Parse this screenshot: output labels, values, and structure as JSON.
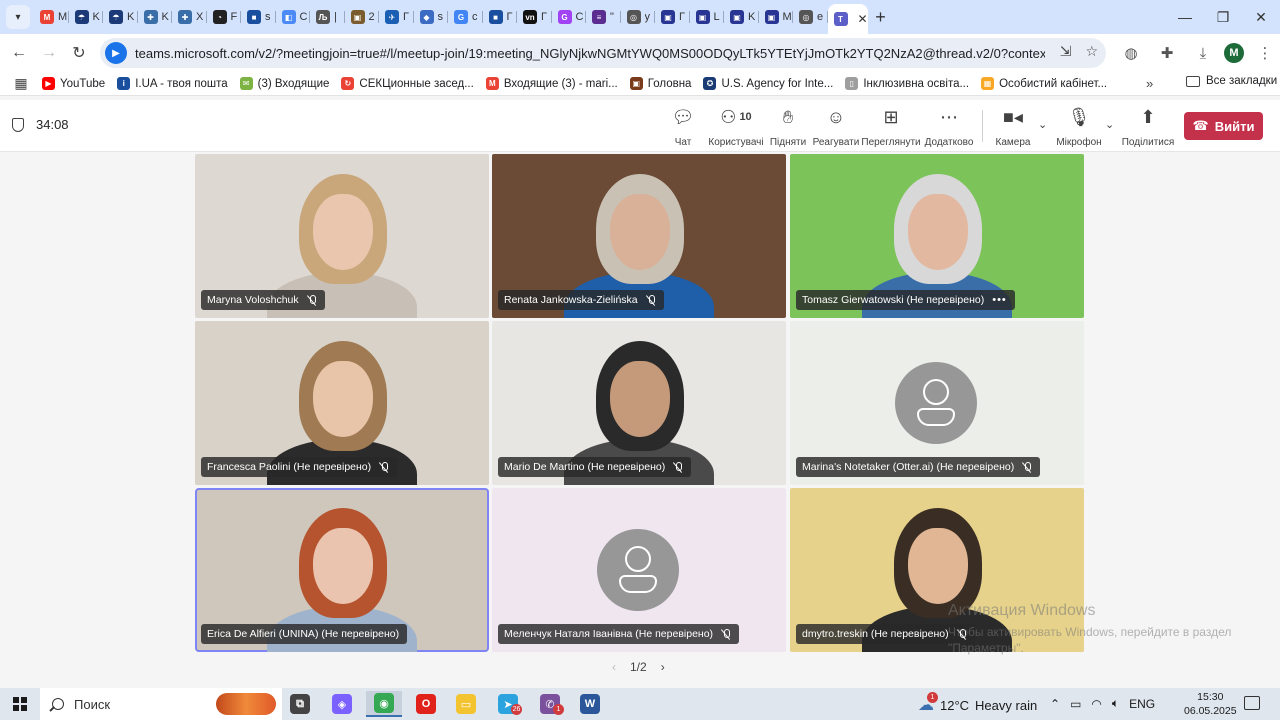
{
  "browser": {
    "tabs": [
      {
        "letter": "M",
        "color": "#ea4335",
        "glyph": "M"
      },
      {
        "letter": "K",
        "color": "#1d3a78",
        "glyph": "☂"
      },
      {
        "letter": "K",
        "color": "#1d3a78",
        "glyph": "☂"
      },
      {
        "letter": "K",
        "color": "#3a6ea8",
        "glyph": "✚"
      },
      {
        "letter": "X",
        "color": "#3a6ea8",
        "glyph": "✚"
      },
      {
        "letter": "F",
        "color": "#222222",
        "glyph": "◔"
      },
      {
        "letter": "s",
        "color": "#1a4fa0",
        "glyph": "■"
      },
      {
        "letter": "C",
        "color": "#4c8bf5",
        "glyph": "◧"
      },
      {
        "letter": "|",
        "color": "#555555",
        "glyph": "Љ"
      },
      {
        "letter": "2",
        "color": "#7a5c2e",
        "glyph": "▣"
      },
      {
        "letter": "Г",
        "color": "#1a5fb4",
        "glyph": "✈"
      },
      {
        "letter": "s",
        "color": "#3c6bc4",
        "glyph": "◆"
      },
      {
        "letter": "c",
        "color": "#4285f4",
        "glyph": "G"
      },
      {
        "letter": "Г",
        "color": "#1a4fa0",
        "glyph": "■"
      },
      {
        "letter": "Г",
        "color": "#111111",
        "glyph": "vn"
      },
      {
        "letter": "C",
        "color": "#a142f4",
        "glyph": "G"
      },
      {
        "letter": "\"",
        "color": "#5b2d91",
        "glyph": "≡"
      },
      {
        "letter": "y",
        "color": "#555555",
        "glyph": "◎"
      },
      {
        "letter": "Г",
        "color": "#283593",
        "glyph": "▣"
      },
      {
        "letter": "L",
        "color": "#283593",
        "glyph": "▣"
      },
      {
        "letter": "K",
        "color": "#283593",
        "glyph": "▣"
      },
      {
        "letter": "M",
        "color": "#283593",
        "glyph": "▣"
      },
      {
        "letter": "e",
        "color": "#555555",
        "glyph": "◎"
      }
    ],
    "active_tab": {
      "letter": "M",
      "color": "#5b5fc7"
    },
    "url": "teams.microsoft.com/v2/?meetingjoin=true#/l/meetup-join/19:meeting_NGlyNjkwNGMtYWQ0MS00ODQyLTk5YTEtYjJmOTk2YTQ2NzA2@thread.v2/0?context=%7b\"Tid\"%3a\"5...",
    "profile_initial": "M",
    "bookmarks": [
      {
        "label": "YouTube",
        "color": "#ff0000",
        "glyph": "▶"
      },
      {
        "label": "I.UA - твоя пошта",
        "color": "#1a4fa0",
        "glyph": "i"
      },
      {
        "label": "(3) Входящие",
        "color": "#7cb342",
        "glyph": "✉"
      },
      {
        "label": "СЕКЦионные засед...",
        "color": "#ea4335",
        "glyph": "↻"
      },
      {
        "label": "Входящие (3) - mari...",
        "color": "#ea4335",
        "glyph": "M"
      },
      {
        "label": "Головна",
        "color": "#7a3b1a",
        "glyph": "▣"
      },
      {
        "label": "U.S. Agency for Inte...",
        "color": "#1a3b73",
        "glyph": "✪"
      },
      {
        "label": "Інклюзивна освіта...",
        "color": "#9e9e9e",
        "glyph": "▯"
      },
      {
        "label": "Особистий кабінет...",
        "color": "#f9a825",
        "glyph": "▦"
      }
    ],
    "bookmarks_all": "Все закладки"
  },
  "meeting": {
    "timer": "34:08",
    "toolbar": {
      "chat": "Чат",
      "people": "Користувачі",
      "people_count": "10",
      "raise": "Підняти",
      "react": "Реагувати",
      "view": "Переглянути",
      "more": "Додатково",
      "camera": "Камера",
      "mic": "Мікрофон",
      "share": "Поділитися",
      "leave": "Вийти"
    },
    "participants": [
      {
        "name": "Maryna Voloshchuk",
        "muted": true,
        "more": false,
        "bg": "#ddd8d2",
        "hair": "#c9a77a",
        "skin": "#e9c6ad",
        "shirt": "#c8bfb6",
        "avatar": false
      },
      {
        "name": "Renata Jankowska-Zielińska",
        "muted": true,
        "more": false,
        "bg": "#6b4a36",
        "hair": "#c9c2b4",
        "skin": "#d9b098",
        "shirt": "#1f5ea8",
        "avatar": false
      },
      {
        "name": "Tomasz Gierwatowski (Не перевірено)",
        "muted": false,
        "more": true,
        "bg": "#7cc35a",
        "hair": "#d8d8d8",
        "skin": "#e2b8a0",
        "shirt": "#3a6ea8",
        "avatar": false
      },
      {
        "name": "Francesca Paolini (Не перевірено)",
        "muted": true,
        "more": false,
        "bg": "#d8d2c8",
        "hair": "#a07a52",
        "skin": "#e8c4a8",
        "shirt": "#2b2b2b",
        "avatar": false
      },
      {
        "name": "Mario De Martino (Не перевірено)",
        "muted": true,
        "more": false,
        "bg": "#e8e6e2",
        "hair": "#2a2a2a",
        "skin": "#c49a7a",
        "shirt": "#4a4a4a",
        "avatar": false
      },
      {
        "name": "Marina's Notetaker (Otter.ai) (Не перевірено)",
        "muted": true,
        "more": false,
        "bg": "#eceeea",
        "avatar": true
      },
      {
        "name": "Erica De Alfieri (UNINA) (Не перевірено)",
        "muted": false,
        "more": false,
        "bg": "#cfc6bc",
        "hair": "#b5542e",
        "skin": "#eac4ae",
        "shirt": "#9fb4cc",
        "avatar": false,
        "speaking": true
      },
      {
        "name": "Меленчук Наталя Іванівна (Не перевірено)",
        "muted": true,
        "more": false,
        "bg": "#f0e6f0",
        "avatar": true
      },
      {
        "name": "dmytro.treskin (Не перевірено)",
        "muted": true,
        "more": false,
        "bg": "#e6d28a",
        "hair": "#3a2e24",
        "skin": "#e0b694",
        "shirt": "#2a2a2a",
        "avatar": false
      }
    ],
    "pager": "1/2"
  },
  "watermark": {
    "title": "Активация Windows",
    "text": "Чтобы активировать Windows, перейдите в раздел \"Параметры\"."
  },
  "taskbar": {
    "search": "Поиск",
    "apps": [
      {
        "name": "task-view",
        "color": "#444444",
        "glyph": "⧉"
      },
      {
        "name": "copilot",
        "color": "#7b61ff",
        "glyph": "◈"
      },
      {
        "name": "chrome",
        "color": "#34a853",
        "glyph": "◉",
        "active": true
      },
      {
        "name": "opera",
        "color": "#e0221a",
        "glyph": "O"
      },
      {
        "name": "file-explorer",
        "color": "#f4c430",
        "glyph": "▭"
      },
      {
        "name": "telegram",
        "color": "#2aa3de",
        "glyph": "➤",
        "badge": "26"
      },
      {
        "name": "viber",
        "color": "#7b519d",
        "glyph": "✆",
        "badge": "1"
      },
      {
        "name": "word",
        "color": "#2b579a",
        "glyph": "W"
      }
    ],
    "weather_badge": "1",
    "temperature": "12°C",
    "weather": "Heavy rain",
    "lang": "ENG",
    "time": "15:30",
    "date": "06.05.2025"
  }
}
